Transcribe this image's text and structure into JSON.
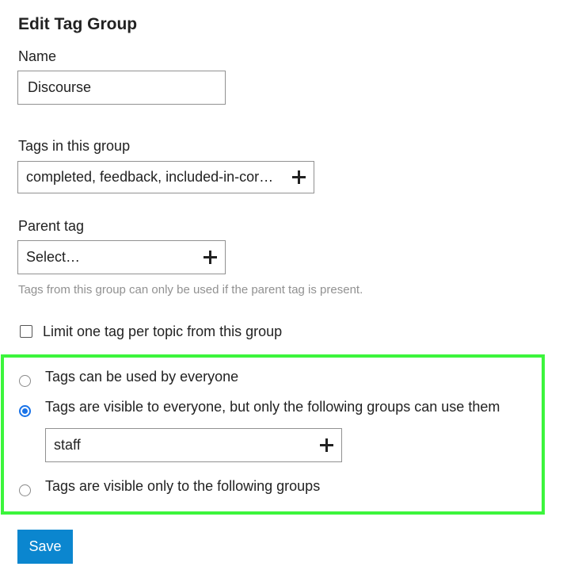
{
  "page": {
    "title": "Edit Tag Group"
  },
  "name_field": {
    "label": "Name",
    "value": "Discourse"
  },
  "tags_field": {
    "label": "Tags in this group",
    "value": "completed, feedback, included-in-cor…",
    "add_icon": "plus-icon"
  },
  "parent_tag_field": {
    "label": "Parent tag",
    "value": "Select…",
    "help": "Tags from this group can only be used if the parent tag is present.",
    "add_icon": "plus-icon"
  },
  "limit_one": {
    "label": "Limit one tag per topic from this group",
    "checked": false
  },
  "permissions": {
    "highlight_color": "#3cf53c",
    "options": [
      {
        "label": "Tags can be used by everyone",
        "selected": false
      },
      {
        "label": "Tags are visible to everyone, but only the following groups can use them",
        "selected": true
      },
      {
        "label": "Tags are visible only to the following groups",
        "selected": false
      }
    ],
    "groups_value": "staff",
    "add_icon": "plus-icon"
  },
  "actions": {
    "save_label": "Save",
    "save_color": "#0b86cf"
  }
}
